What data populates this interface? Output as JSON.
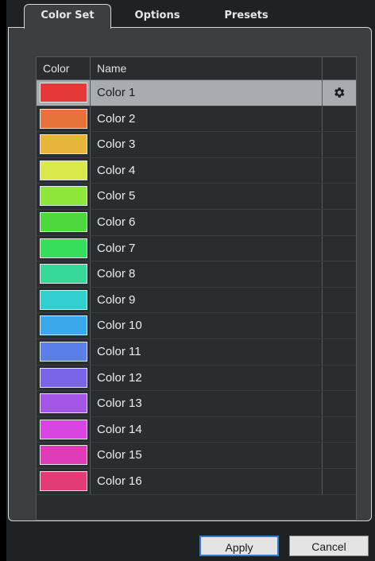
{
  "tabs": [
    {
      "label": "Color Set",
      "active": true
    },
    {
      "label": "Options",
      "active": false
    },
    {
      "label": "Presets",
      "active": false
    }
  ],
  "table": {
    "headers": {
      "color": "Color",
      "name": "Name"
    },
    "rows": [
      {
        "name": "Color 1",
        "color": "#e53838",
        "selected": true
      },
      {
        "name": "Color 2",
        "color": "#e8733a",
        "selected": false
      },
      {
        "name": "Color 3",
        "color": "#e7b53b",
        "selected": false
      },
      {
        "name": "Color 4",
        "color": "#d9e84a",
        "selected": false
      },
      {
        "name": "Color 5",
        "color": "#8ee63a",
        "selected": false
      },
      {
        "name": "Color 6",
        "color": "#4ed840",
        "selected": false
      },
      {
        "name": "Color 7",
        "color": "#36de5c",
        "selected": false
      },
      {
        "name": "Color 8",
        "color": "#37d898",
        "selected": false
      },
      {
        "name": "Color 9",
        "color": "#33cfd0",
        "selected": false
      },
      {
        "name": "Color 10",
        "color": "#3aa8ea",
        "selected": false
      },
      {
        "name": "Color 11",
        "color": "#5a7fe8",
        "selected": false
      },
      {
        "name": "Color 12",
        "color": "#7a64e8",
        "selected": false
      },
      {
        "name": "Color 13",
        "color": "#a455e6",
        "selected": false
      },
      {
        "name": "Color 14",
        "color": "#d845e0",
        "selected": false
      },
      {
        "name": "Color 15",
        "color": "#e03cb8",
        "selected": false
      },
      {
        "name": "Color 16",
        "color": "#e33a78",
        "selected": false
      }
    ],
    "row_action_icon": "gear-icon"
  },
  "buttons": {
    "apply_label": "Apply",
    "cancel_label": "Cancel"
  }
}
